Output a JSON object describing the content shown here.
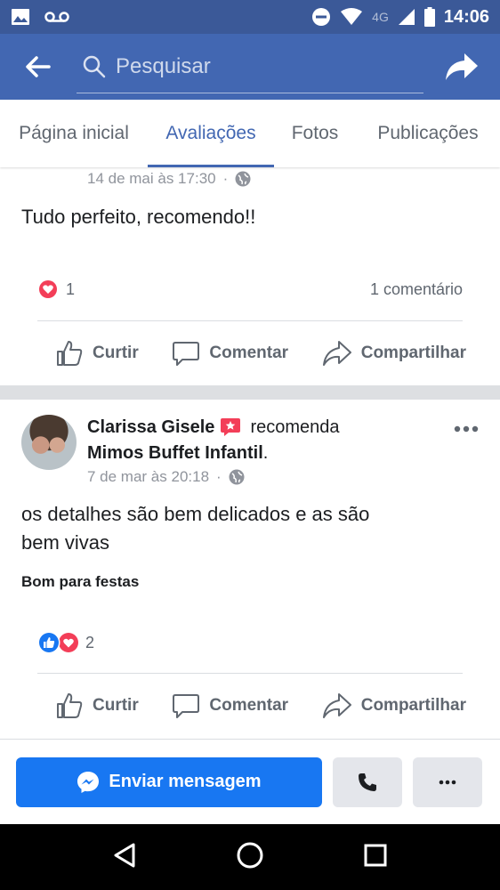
{
  "status_bar": {
    "time": "14:06",
    "network": "4G"
  },
  "header": {
    "search_placeholder": "Pesquisar"
  },
  "tabs": [
    {
      "label": "Página inicial",
      "active": false
    },
    {
      "label": "Avaliações",
      "active": true
    },
    {
      "label": "Fotos",
      "active": false
    },
    {
      "label": "Publicações",
      "active": false
    }
  ],
  "post1": {
    "timestamp": "14 de mai às 17:30",
    "text": "Tudo perfeito, recomendo!!",
    "reaction_count": "1",
    "comments": "1 comentário"
  },
  "post2": {
    "author": "Clarissa Gisele",
    "verb": "recomenda",
    "page": "Mimos Buffet Infantil",
    "timestamp": "7 de mar às 20:18",
    "text_line1": "os detalhes são bem delicados e as são",
    "text_line2": "bem vivas",
    "tag": "Bom para festas",
    "reaction_count": "2"
  },
  "actions": {
    "like": "Curtir",
    "comment": "Comentar",
    "share": "Compartilhar"
  },
  "bottom": {
    "send_message": "Enviar mensagem"
  },
  "colors": {
    "brand": "#4267b2",
    "status_bar": "#3b5998",
    "messenger_blue": "#1877f2",
    "love_red": "#f33e58"
  }
}
